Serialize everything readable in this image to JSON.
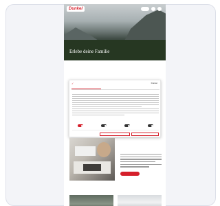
{
  "brand": {
    "logo_text": "Dunkel"
  },
  "hero": {
    "title": "Erlebe deine Familie"
  },
  "consent": {
    "brand_label": "Dunkel",
    "tabs": [
      "",
      "",
      ""
    ],
    "heading": "",
    "toggles": [
      "",
      "",
      "",
      ""
    ],
    "buttons": {
      "save_selection": "",
      "accept_all": ""
    }
  },
  "colors": {
    "brand_red": "#d51f2b",
    "hero_forest": "#263722"
  }
}
